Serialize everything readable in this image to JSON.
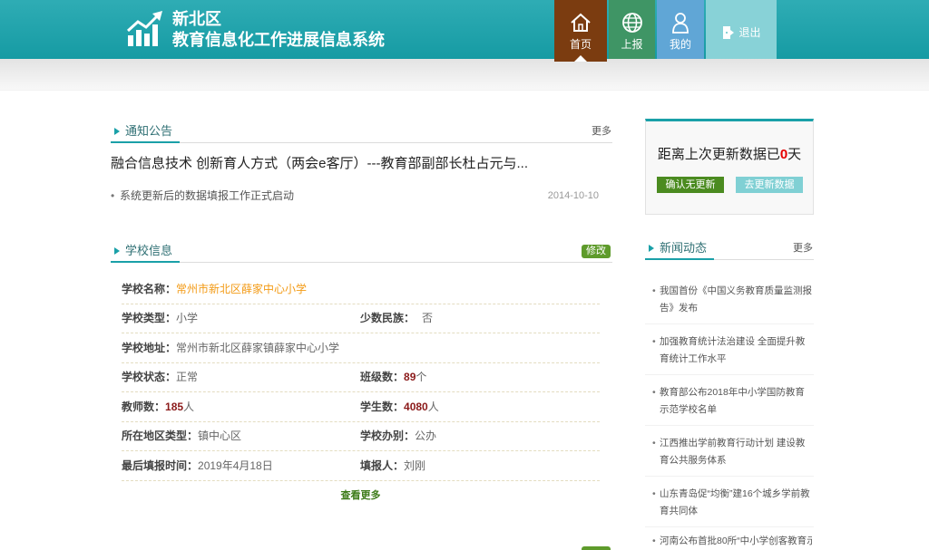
{
  "header": {
    "district": "新北区",
    "system_title": "教育信息化工作进展信息系统",
    "logo_icon": "bar-chart-growth-icon",
    "background_color": "#17a3ac"
  },
  "nav": {
    "home": {
      "label": "首页",
      "icon": "home-icon",
      "color": "#7b3c10",
      "active": true
    },
    "report": {
      "label": "上报",
      "icon": "globe-icon",
      "color": "#3f9565"
    },
    "mine": {
      "label": "我的",
      "icon": "user-icon",
      "color": "#60a6d6"
    },
    "logout": {
      "label": "退出",
      "icon": "logout-icon",
      "color": "#88d2d7"
    }
  },
  "notice": {
    "title": "通知公告",
    "more": "更多",
    "headline": "融合信息技术 创新育人方式（两会e客厅）---教育部副部长杜占元与...",
    "items": [
      {
        "text": "系统更新后的数据填报工作正式启动",
        "date": "2014-10-10"
      }
    ]
  },
  "school": {
    "title": "学校信息",
    "edit": "修改",
    "edit_color": "#5e9b2b",
    "highlight_color": "#f39a14",
    "number_color": "#8b1a1a",
    "fields": {
      "name": {
        "label": "学校名称：",
        "value": "常州市新北区薛家中心小学"
      },
      "type": {
        "label": "学校类型：",
        "value": "小学"
      },
      "minority": {
        "label": "少数民族：",
        "value": "否"
      },
      "address": {
        "label": "学校地址：",
        "value": "常州市新北区薛家镇薛家中心小学"
      },
      "status": {
        "label": "学校状态：",
        "value": "正常"
      },
      "classes": {
        "label": "班级数：",
        "value": "89",
        "unit": "个"
      },
      "teachers": {
        "label": "教师数：",
        "value": "185",
        "unit": "人"
      },
      "students": {
        "label": "学生数：",
        "value": "4080",
        "unit": "人"
      },
      "area_type": {
        "label": "所在地区类型：",
        "value": "镇中心区"
      },
      "ownership": {
        "label": "学校办别：",
        "value": "公办"
      },
      "last_report": {
        "label": "最后填报时间：",
        "value": "2019年4月18日"
      },
      "reporter": {
        "label": "填报人：",
        "value": "刘刚"
      }
    },
    "view_more": "查看更多"
  },
  "update_reminder": {
    "prefix": "距离上次更新数据已",
    "days": "0",
    "suffix": "天",
    "confirm_button": "确认无更新",
    "confirm_color": "#4b8b20",
    "update_button": "去更新数据",
    "update_color": "#80d0d4"
  },
  "news": {
    "title": "新闻动态",
    "more": "更多",
    "items": [
      "我国首份《中国义务教育质量监测报告》发布",
      "加强教育统计法治建设 全面提升教育统计工作水平",
      "教育部公布2018年中小学国防教育示范学校名单",
      "江西推出学前教育行动计划 建设教育公共服务体系",
      "山东青岛促“均衡”建16个城乡学前教育共同体",
      "河南公布首批80所“中小学创客教育示"
    ]
  }
}
